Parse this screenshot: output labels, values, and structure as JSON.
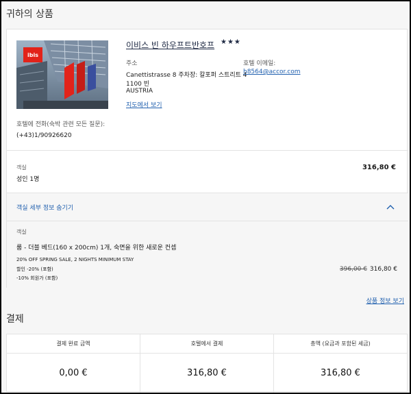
{
  "page": {
    "title": "귀하의 상품",
    "payment_title": "결제",
    "product_info_link": "상품 정보 보기"
  },
  "hotel": {
    "name": "이비스 빈 하우프트반호프",
    "stars": "★★★",
    "image_logo_text": "ibis",
    "address_label": "주소",
    "address_line1": "Canettistrasse 8 주차장: 칼포퍼 스트리트 4",
    "address_line2": "1100 빈",
    "address_line3": "AUSTRIA",
    "email_label": "호텔 이메일:",
    "email": "h8564@accor.com",
    "map_link": "지도에서 보기",
    "phone_label": "호텔에 전화(숙박 관련 모든 질문):",
    "phone": "(+43)1/90926620"
  },
  "room": {
    "label": "객실",
    "occupancy": "성인 1명",
    "price": "316,80 €",
    "toggle_label": "객실 세부 정보 숨기기",
    "details_label": "객실",
    "details_name": "룸 - 더블 베드(160 x 200cm) 1개, 숙면을 위한 새로운 컨셉",
    "offer_name": "20% OFF SPRING SALE, 2 NIGHTS MINIMUM STAY",
    "discount1": "할인 -20% (포함)",
    "discount2": "-10% 회원가 (포함)",
    "original_price": "396,00 €",
    "final_price": "316,80 €"
  },
  "payment": {
    "columns": [
      {
        "label": "결제 완료 금액",
        "value": "0,00 €"
      },
      {
        "label": "호텔에서 결제",
        "value": "316,80 €"
      },
      {
        "label": "총액 (요금과 포함된 세금)",
        "value": "316,80 €"
      }
    ]
  },
  "colors": {
    "accent_link": "#1f5fae",
    "background": "#f6f6f6",
    "ibis_red": "#e2231a"
  }
}
